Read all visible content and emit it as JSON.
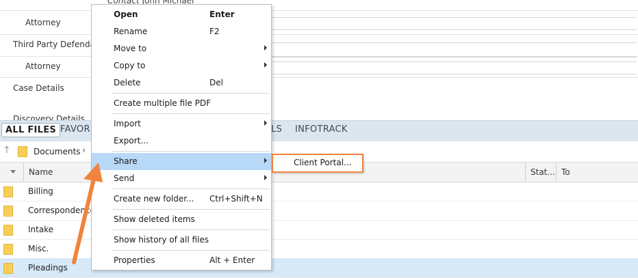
{
  "details": {
    "contact_label": "Contact",
    "contact_name": "John Michael",
    "rows": [
      {
        "label": "Attorney"
      },
      {
        "label": "Third Party Defenda"
      },
      {
        "label": "Attorney"
      },
      {
        "label": "Case Details"
      },
      {
        "label": "Discovery Details"
      }
    ]
  },
  "tabs": {
    "all_files": "ALL FILES",
    "favorites": "FAVORI",
    "other": "LS",
    "infotrack": "INFOTRACK"
  },
  "breadcrumb": {
    "documents": "Documents"
  },
  "table": {
    "columns": {
      "name": "Name",
      "status": "Stat...",
      "to": "To"
    },
    "rows": [
      {
        "name": "Billing"
      },
      {
        "name": "Correspondence"
      },
      {
        "name": "Intake"
      },
      {
        "name": "Misc."
      },
      {
        "name": "Pleadings"
      }
    ]
  },
  "context_menu": {
    "items": [
      {
        "label": "Open",
        "shortcut": "Enter"
      },
      {
        "label": "Rename",
        "shortcut": "F2"
      },
      {
        "label": "Move to"
      },
      {
        "label": "Copy to"
      },
      {
        "label": "Delete",
        "shortcut": "Del"
      },
      {
        "label": "Create multiple file PDF"
      },
      {
        "label": "Import"
      },
      {
        "label": "Export..."
      },
      {
        "label": "Share"
      },
      {
        "label": "Send"
      },
      {
        "label": "Create new folder...",
        "shortcut": "Ctrl+Shift+N"
      },
      {
        "label": "Show deleted items"
      },
      {
        "label": "Show history of all files"
      },
      {
        "label": "Properties",
        "shortcut": "Alt + Enter"
      }
    ]
  },
  "submenu": {
    "client_portal": "Client Portal..."
  },
  "colors": {
    "highlight": "#b8d8f8",
    "annotation": "#f0843c",
    "selected_row": "#d7e9f7"
  }
}
